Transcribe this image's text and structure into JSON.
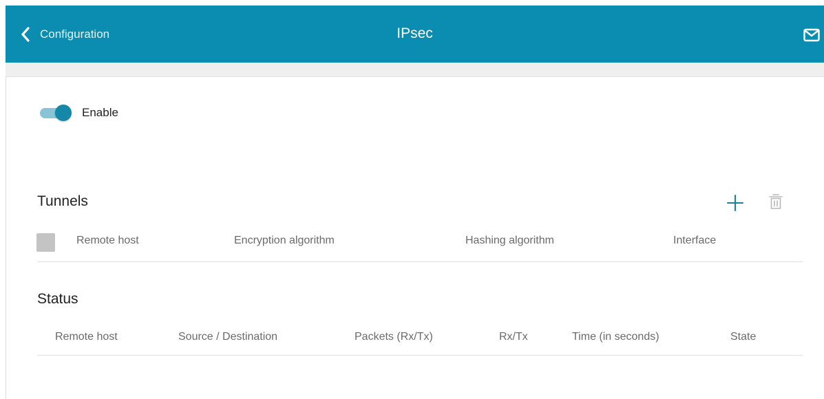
{
  "header": {
    "back_label": "Configuration",
    "title": "IPsec",
    "back_icon": "chevron-left-icon",
    "mail_icon": "mail-icon"
  },
  "enable_toggle": {
    "label": "Enable",
    "checked": true
  },
  "tunnels": {
    "title": "Tunnels",
    "add_icon": "plus-icon",
    "delete_icon": "trash-icon",
    "columns": [
      "Remote host",
      "Encryption algorithm",
      "Hashing algorithm",
      "Interface"
    ],
    "rows": []
  },
  "status": {
    "title": "Status",
    "columns": [
      "Remote host",
      "Source / Destination",
      "Packets (Rx/Tx)",
      "Rx/Tx",
      "Time (in seconds)",
      "State"
    ],
    "rows": []
  },
  "colors": {
    "header_bg": "#0a8db0",
    "accent": "#1588aa",
    "toggle_track": "#86c4d6",
    "icon_teal": "#1a7f9a"
  }
}
